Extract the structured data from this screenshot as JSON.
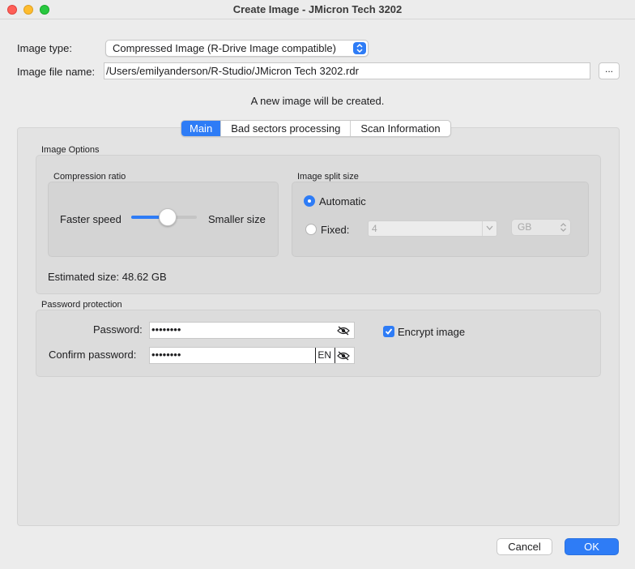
{
  "window": {
    "title": "Create Image - JMicron Tech 3202"
  },
  "form": {
    "image_type_label": "Image type:",
    "image_type_value": "Compressed Image (R-Drive Image compatible)",
    "file_name_label": "Image file name:",
    "file_name_value": "/Users/emilyanderson/R-Studio/JMicron Tech 3202.rdr",
    "browse_label": "...",
    "info_message": "A new image will be created."
  },
  "tabs": [
    {
      "label": "Main",
      "active": true
    },
    {
      "label": "Bad sectors processing",
      "active": false
    },
    {
      "label": "Scan Information",
      "active": false
    }
  ],
  "image_options": {
    "title": "Image Options",
    "compression": {
      "title": "Compression ratio",
      "left_label": "Faster speed",
      "right_label": "Smaller size",
      "slider_value": 0.55
    },
    "split": {
      "title": "Image split size",
      "automatic_label": "Automatic",
      "fixed_label": "Fixed:",
      "fixed_value": "4",
      "unit_value": "GB",
      "selected": "automatic"
    },
    "estimated_size": "Estimated size: 48.62 GB"
  },
  "password": {
    "title": "Password protection",
    "password_label": "Password:",
    "password_value": "••••••••",
    "confirm_label": "Confirm password:",
    "confirm_value": "••••••••",
    "input_language": "EN",
    "encrypt_label": "Encrypt image",
    "encrypt_checked": true
  },
  "buttons": {
    "cancel": "Cancel",
    "ok": "OK"
  },
  "colors": {
    "accent": "#2e7cf6",
    "close": "#fe5f57",
    "minimize": "#febc2e",
    "maximize": "#28c840"
  }
}
